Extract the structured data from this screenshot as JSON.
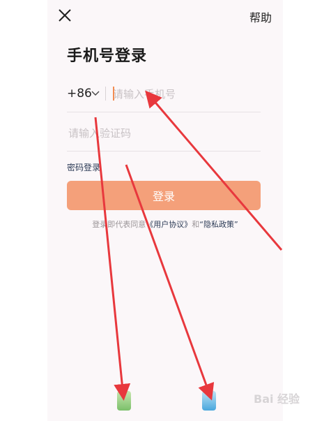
{
  "header": {
    "help_label": "帮助"
  },
  "page_title": "手机号登录",
  "phone": {
    "country_code": "+86",
    "placeholder": "请输入手机号"
  },
  "code": {
    "placeholder": "请输入验证码"
  },
  "password_login_label": "密码登录",
  "login_button_label": "登录",
  "agreement": {
    "prefix": "登录即代表同意",
    "user_agreement": "《用户协议》",
    "conjunction": "和",
    "privacy_policy": "“隐私政策”"
  },
  "watermark": "Bai 经验",
  "colors": {
    "accent": "#f4a07a",
    "annotation_arrow": "#e8383d",
    "link": "#2b3a55"
  },
  "icons": [
    "close-icon",
    "chevron-down-icon",
    "wechat-login-icon",
    "other-login-icon"
  ]
}
